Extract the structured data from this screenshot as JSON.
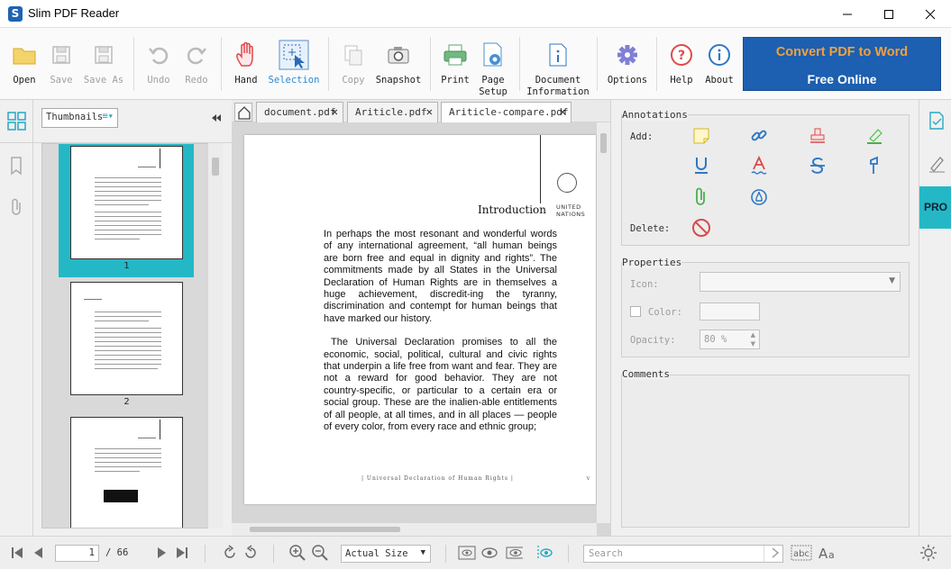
{
  "app": {
    "title": "Slim PDF Reader",
    "logo_letter": "S"
  },
  "toolbar": {
    "open": "Open",
    "save": "Save",
    "save_as": "Save As",
    "undo": "Undo",
    "redo": "Redo",
    "hand": "Hand",
    "selection": "Selection",
    "copy": "Copy",
    "snapshot": "Snapshot",
    "print": "Print",
    "page_setup_1": "Page",
    "page_setup_2": "Setup",
    "doc_info_1": "Document",
    "doc_info_2": "Information",
    "options": "Options",
    "help": "Help",
    "about": "About",
    "convert_line1": "Convert PDF to Word",
    "convert_line2": "Free Online"
  },
  "thumbnails": {
    "dropdown": "Thumbnails",
    "pages": [
      "1",
      "2"
    ]
  },
  "tabs": [
    {
      "label": "document.pdf"
    },
    {
      "label": "Ariticle.pdf"
    },
    {
      "label": "Ariticle-compare.pdf"
    }
  ],
  "document": {
    "title": "Introduction",
    "org_line1": "UNITED",
    "org_line2": "NATIONS",
    "para1": "In perhaps the most resonant and wonderful words of any international agreement, “all human beings are born free and equal in dignity and rights”. The commitments made by all States in the Universal Declaration of Human Rights are in themselves a huge achievement, discredit-ing the tyranny, discrimination and contempt for human beings that have marked our history.",
    "para2": "The Universal Declaration promises to all the economic, social, political, cultural and civic rights that underpin a life free from want and fear. They are not a reward for good behavior. They are not country-specific, or particular to a certain era or social group. These are the inalien-able entitlements of all people, at all times, and in all places — people of every color, from every race and ethnic group;",
    "footer": "| Universal Declaration of Human Rights |",
    "footer_page": "v"
  },
  "annotations": {
    "group_title": "Annotations",
    "add_label": "Add:",
    "delete_label": "Delete:"
  },
  "properties": {
    "group_title": "Properties",
    "icon_label": "Icon:",
    "color_label": "Color:",
    "opacity_label": "Opacity:",
    "opacity_value": "80 %"
  },
  "comments": {
    "group_title": "Comments"
  },
  "pro_badge": "PRO",
  "statusbar": {
    "current_page": "1",
    "total_pages": "/ 66",
    "zoom": "Actual Size",
    "search_placeholder": "Search"
  },
  "colors": {
    "accent": "#24b8c6",
    "brand": "#1d5fb0",
    "convert_text": "#f5a03a",
    "selection": "#2a8ad4"
  }
}
